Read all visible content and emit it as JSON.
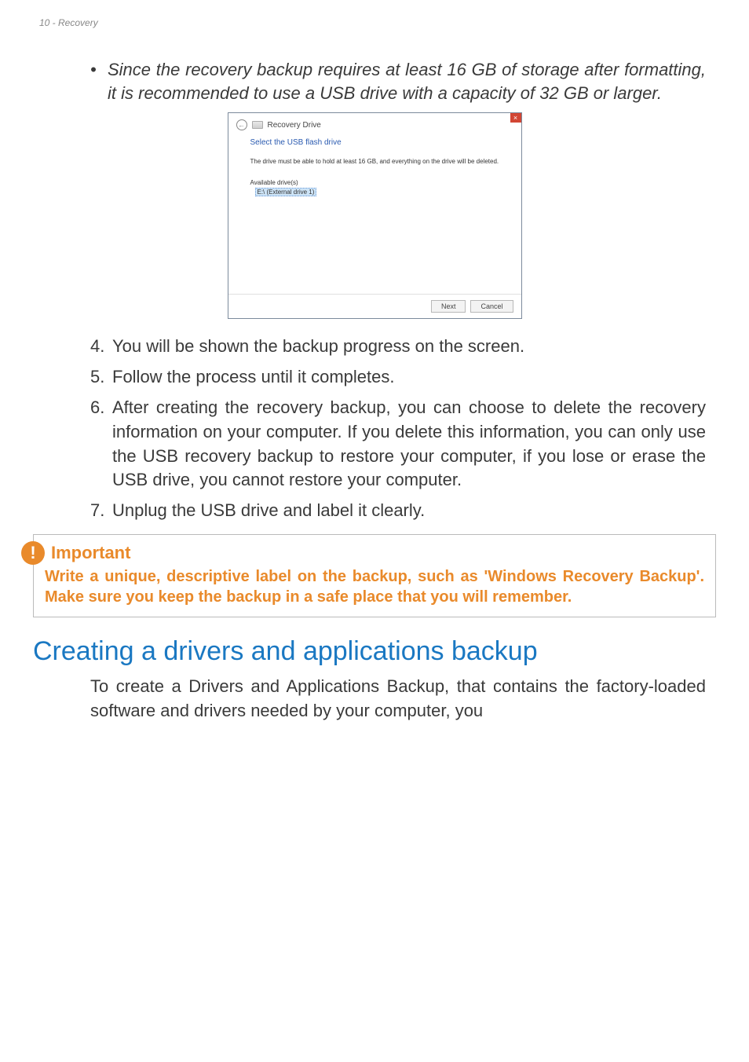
{
  "header": {
    "text": "10 - Recovery"
  },
  "bullet": {
    "marker": "•",
    "text": "Since the recovery backup requires at least 16 GB of storage after formatting, it is recommended to use a USB drive with a capacity of 32 GB or larger."
  },
  "dialog": {
    "close": "×",
    "back_glyph": "←",
    "title": "Recovery Drive",
    "heading": "Select the USB flash drive",
    "message": "The drive must be able to hold at least 16 GB, and everything on the drive will be deleted.",
    "available_label": "Available drive(s)",
    "selected_drive": "E:\\ (External drive 1)",
    "next": "Next",
    "cancel": "Cancel"
  },
  "steps": [
    {
      "n": "4.",
      "text": "You will be shown the backup progress on the screen."
    },
    {
      "n": "5.",
      "text": "Follow the process until it completes."
    },
    {
      "n": "6.",
      "text": "After creating the recovery backup, you can choose to delete the recovery information on your computer. If you delete this information, you can only use the USB recovery backup to restore your computer, if you lose or erase the USB drive, you cannot restore your computer."
    },
    {
      "n": "7.",
      "text": "Unplug the USB drive and label it clearly."
    }
  ],
  "callout": {
    "icon": "!",
    "title": "Important",
    "body": "Write a unique, descriptive label on the backup, such as 'Windows Recovery Backup'. Make sure you keep the backup in a safe place that you will remember."
  },
  "section": {
    "heading": "Creating a drivers and applications backup",
    "paragraph": "To create a Drivers and Applications Backup, that contains the factory-loaded software and drivers needed by your computer, you"
  }
}
